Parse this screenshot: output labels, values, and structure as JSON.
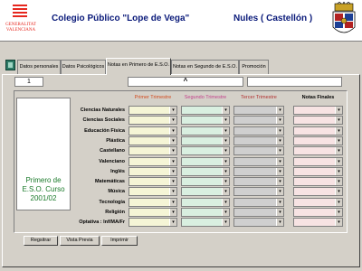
{
  "header": {
    "logo_line1": "GENERALITAT",
    "logo_line2": "VALENCIANA",
    "title": "Colegio Público \"Lope de Vega\"",
    "city": "Nules ( Castellón )"
  },
  "tabs": [
    {
      "label": "Datos personales"
    },
    {
      "label": "Datos Psicológicos"
    },
    {
      "label": "Notas en Primero de E.S.O."
    },
    {
      "label": "Notas en Segundo de E.S.O."
    },
    {
      "label": "Promoción"
    }
  ],
  "active_tab": 2,
  "record_number": "1",
  "sort_symbol": "^",
  "course_label": "Primero de E.S.O. Curso 2001/02",
  "columns": {
    "t1": "Primer Trimestre",
    "t2": "Segundo Trimestre",
    "t3": "Tercer Trimestre",
    "final": "Notas Finales"
  },
  "colors": {
    "t1_header": "#d24a1e",
    "t2_header": "#c23f8a",
    "t3_header": "#b03030",
    "final_header": "#000000",
    "title": "#0a1a7a",
    "course_label": "#1a7a2a"
  },
  "subjects": [
    "Ciencias Naturales",
    "Ciencias Sociales",
    "Educación Física",
    "Plástica",
    "Castellano",
    "Valenciano",
    "Inglés",
    "Matemáticas",
    "Música",
    "Tecnología",
    "Religión",
    "Optativa : Inf/MA/Fr"
  ],
  "buttons": {
    "register": "Regsitrar",
    "preview": "Vista Previa",
    "print": "Imprimir"
  }
}
